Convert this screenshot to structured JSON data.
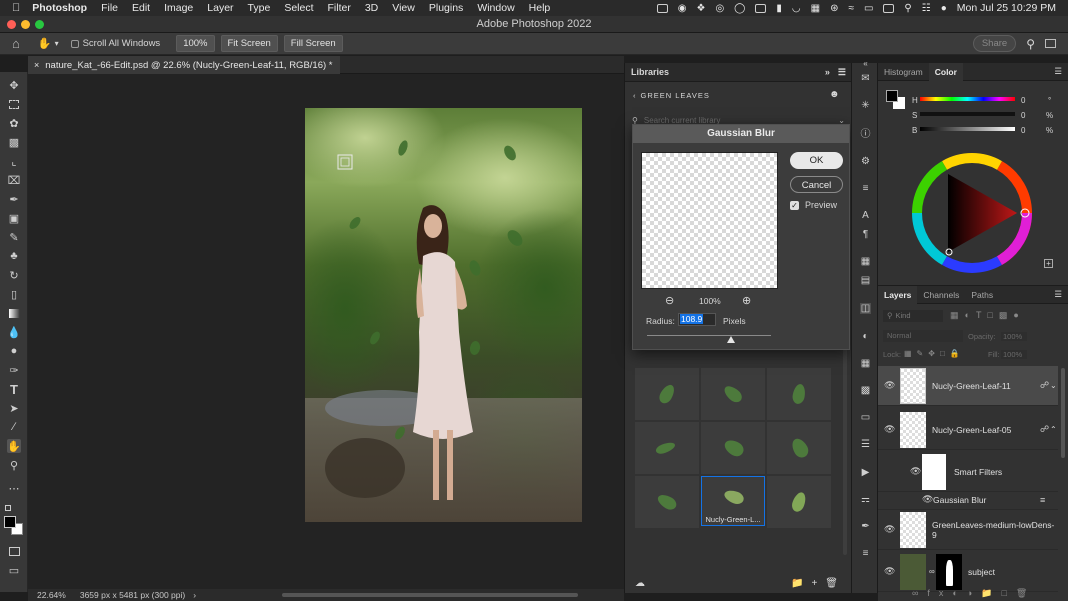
{
  "menubar": {
    "apple": "",
    "app_name": "Photoshop",
    "items": [
      "File",
      "Edit",
      "Image",
      "Layer",
      "Type",
      "Select",
      "Filter",
      "3D",
      "View",
      "Plugins",
      "Window",
      "Help"
    ],
    "datetime": "Mon Jul 25  10:29 PM"
  },
  "window": {
    "title": "Adobe Photoshop 2022"
  },
  "options": {
    "scroll_all_label": "Scroll All Windows",
    "zoom_button": "100%",
    "fit_screen": "Fit Screen",
    "fill_screen": "Fill Screen",
    "share": "Share"
  },
  "document": {
    "tab_title": "nature_Kat_-66-Edit.psd @ 22.6% (Nucly-Green-Leaf-11, RGB/16) *",
    "zoom": "22.64%",
    "info": "3659 px x 5481 px (300 ppi)"
  },
  "libraries": {
    "title": "Libraries",
    "breadcrumb": "GREEN LEAVES",
    "search_placeholder": "Search current library",
    "selected_item_label": "Nucly-Green-L..."
  },
  "gaussian_blur": {
    "title": "Gaussian Blur",
    "ok": "OK",
    "cancel": "Cancel",
    "preview_label": "Preview",
    "preview_checked": true,
    "zoom": "100%",
    "radius_label": "Radius:",
    "radius_value": "108.9",
    "unit": "Pixels",
    "slider_fraction": 0.68
  },
  "color_panel": {
    "tabs": [
      "Histogram",
      "Color"
    ],
    "active_tab": "Color",
    "h_label": "H",
    "h_value": "0",
    "h_unit": "°",
    "s_label": "S",
    "s_value": "0",
    "s_unit": "%",
    "b_label": "B",
    "b_value": "0",
    "b_unit": "%"
  },
  "layers_panel": {
    "tabs": [
      "Layers",
      "Channels",
      "Paths"
    ],
    "active_tab": "Layers",
    "kind_label": "Kind",
    "blend_mode": "Normal",
    "opacity_label": "Opacity:",
    "opacity_value": "100%",
    "lock_label": "Lock:",
    "fill_label": "Fill:",
    "fill_value": "100%",
    "layers": [
      {
        "name": "Nucly-Green-Leaf-11"
      },
      {
        "name": "Nucly-Green-Leaf-05"
      },
      {
        "name": "Smart Filters"
      },
      {
        "name": "Gaussian Blur"
      },
      {
        "name": "GreenLeaves-medium-lowDens-9"
      },
      {
        "name": "subject"
      }
    ]
  },
  "colors": {
    "accent": "#1473e6",
    "ok_button": "#e8e8e8",
    "selected_layer": "#4a4a4a"
  }
}
